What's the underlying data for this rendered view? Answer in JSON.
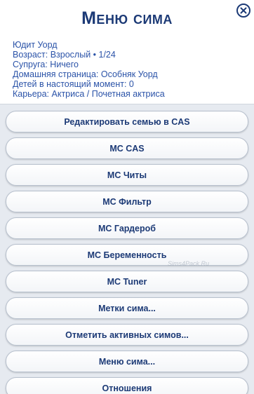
{
  "dialog": {
    "title": "Меню сима",
    "close_icon": "close-icon"
  },
  "sim_info": {
    "name": "Юдит Уорд",
    "age": "Возраст: Взрослый • 1/24",
    "spouse": "Супруга: Ничего",
    "home": "Домашняя страница: Особняк Уорд",
    "children": "Детей в настоящий момент: 0",
    "career": "Карьера: Актриса / Почетная актриса"
  },
  "menu": {
    "items": [
      {
        "label": "Редактировать семью в CAS"
      },
      {
        "label": "MC CAS"
      },
      {
        "label": "MC Читы"
      },
      {
        "label": "MC Фильтр"
      },
      {
        "label": "MC Гардероб"
      },
      {
        "label": "MC Беременность"
      },
      {
        "label": "MC Tuner"
      },
      {
        "label": "Метки сима..."
      },
      {
        "label": "Отметить активных симов..."
      },
      {
        "label": "Меню сима..."
      },
      {
        "label": "Отношения"
      }
    ]
  },
  "watermark": "Sims4Pack.Ru",
  "colors": {
    "title": "#1c3a76",
    "info_text": "#2b53a8",
    "button_text": "#1c3a76",
    "menu_background": "#e6eaf0"
  }
}
